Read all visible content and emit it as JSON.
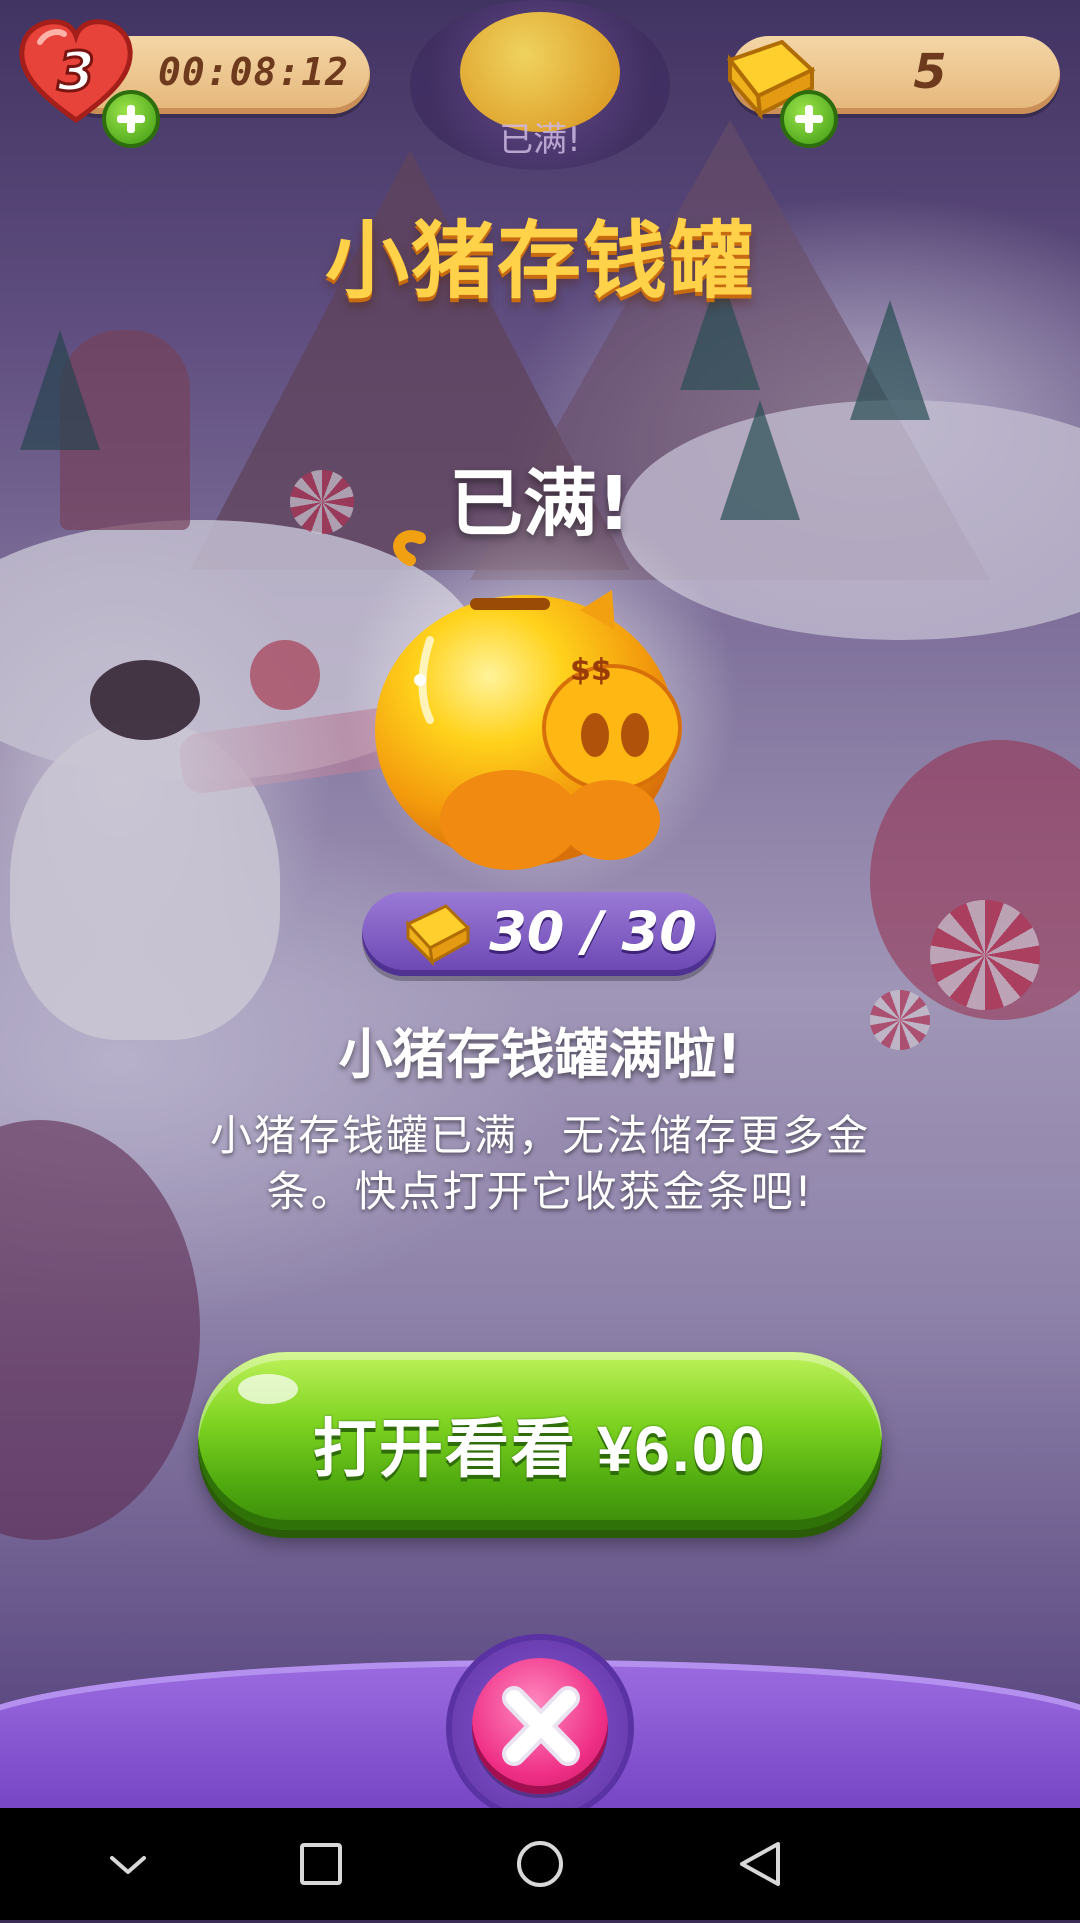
{
  "hud": {
    "lives_count": "3",
    "lives_timer": "00:08:12",
    "gold_count": "5",
    "piggy_status_mini": "已满!"
  },
  "piggy_bank": {
    "title": "小猪存钱罐",
    "full_label": "已满!",
    "counter_text": "30 / 30",
    "current": 30,
    "capacity": 30,
    "subtitle": "小猪存钱罐满啦!",
    "description_line1": "小猪存钱罐已满，无法储存更多金",
    "description_line2": "条。快点打开它收获金条吧!"
  },
  "open_button": {
    "label": "打开看看 ¥6.00"
  },
  "icons": {
    "heart": "heart-icon",
    "gold": "gold-bar-icon",
    "plus": "plus-icon",
    "close": "close-icon",
    "piggy": "piggy-bank-icon"
  },
  "colors": {
    "title": "#ffd24a",
    "button_green": "#7ed321",
    "counter_purple": "#7a56c2",
    "close_pink": "#ef2f86",
    "panel_purple": "#7a4ac8"
  },
  "system_nav": {
    "items": [
      "collapse-icon",
      "recent-apps-icon",
      "home-icon",
      "back-icon"
    ]
  }
}
